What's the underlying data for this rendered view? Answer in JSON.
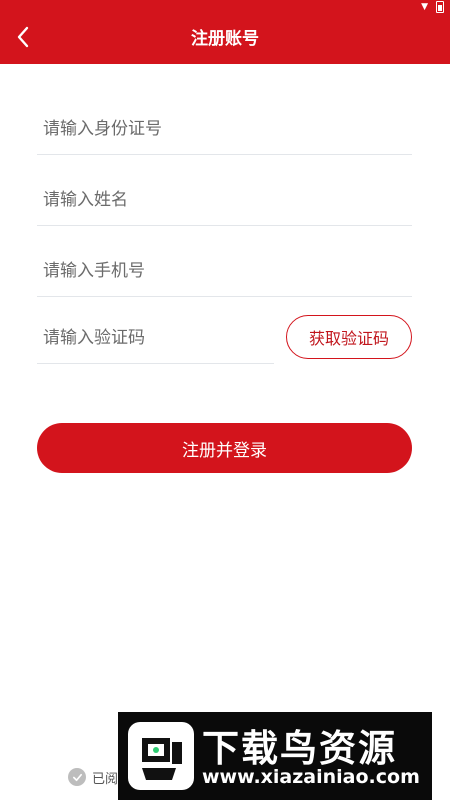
{
  "header": {
    "title": "注册账号",
    "back_icon": "chevron-left-icon",
    "color": "#d3141c"
  },
  "form": {
    "id_placeholder": "请输入身份证号",
    "name_placeholder": "请输入姓名",
    "phone_placeholder": "请输入手机号",
    "code_placeholder": "请输入验证码",
    "get_code_label": "获取验证码",
    "submit_label": "注册并登录"
  },
  "agreement": {
    "text": "已阅"
  },
  "watermark": {
    "title": "下载鸟资源",
    "url": "www.xiazainiao.com"
  }
}
